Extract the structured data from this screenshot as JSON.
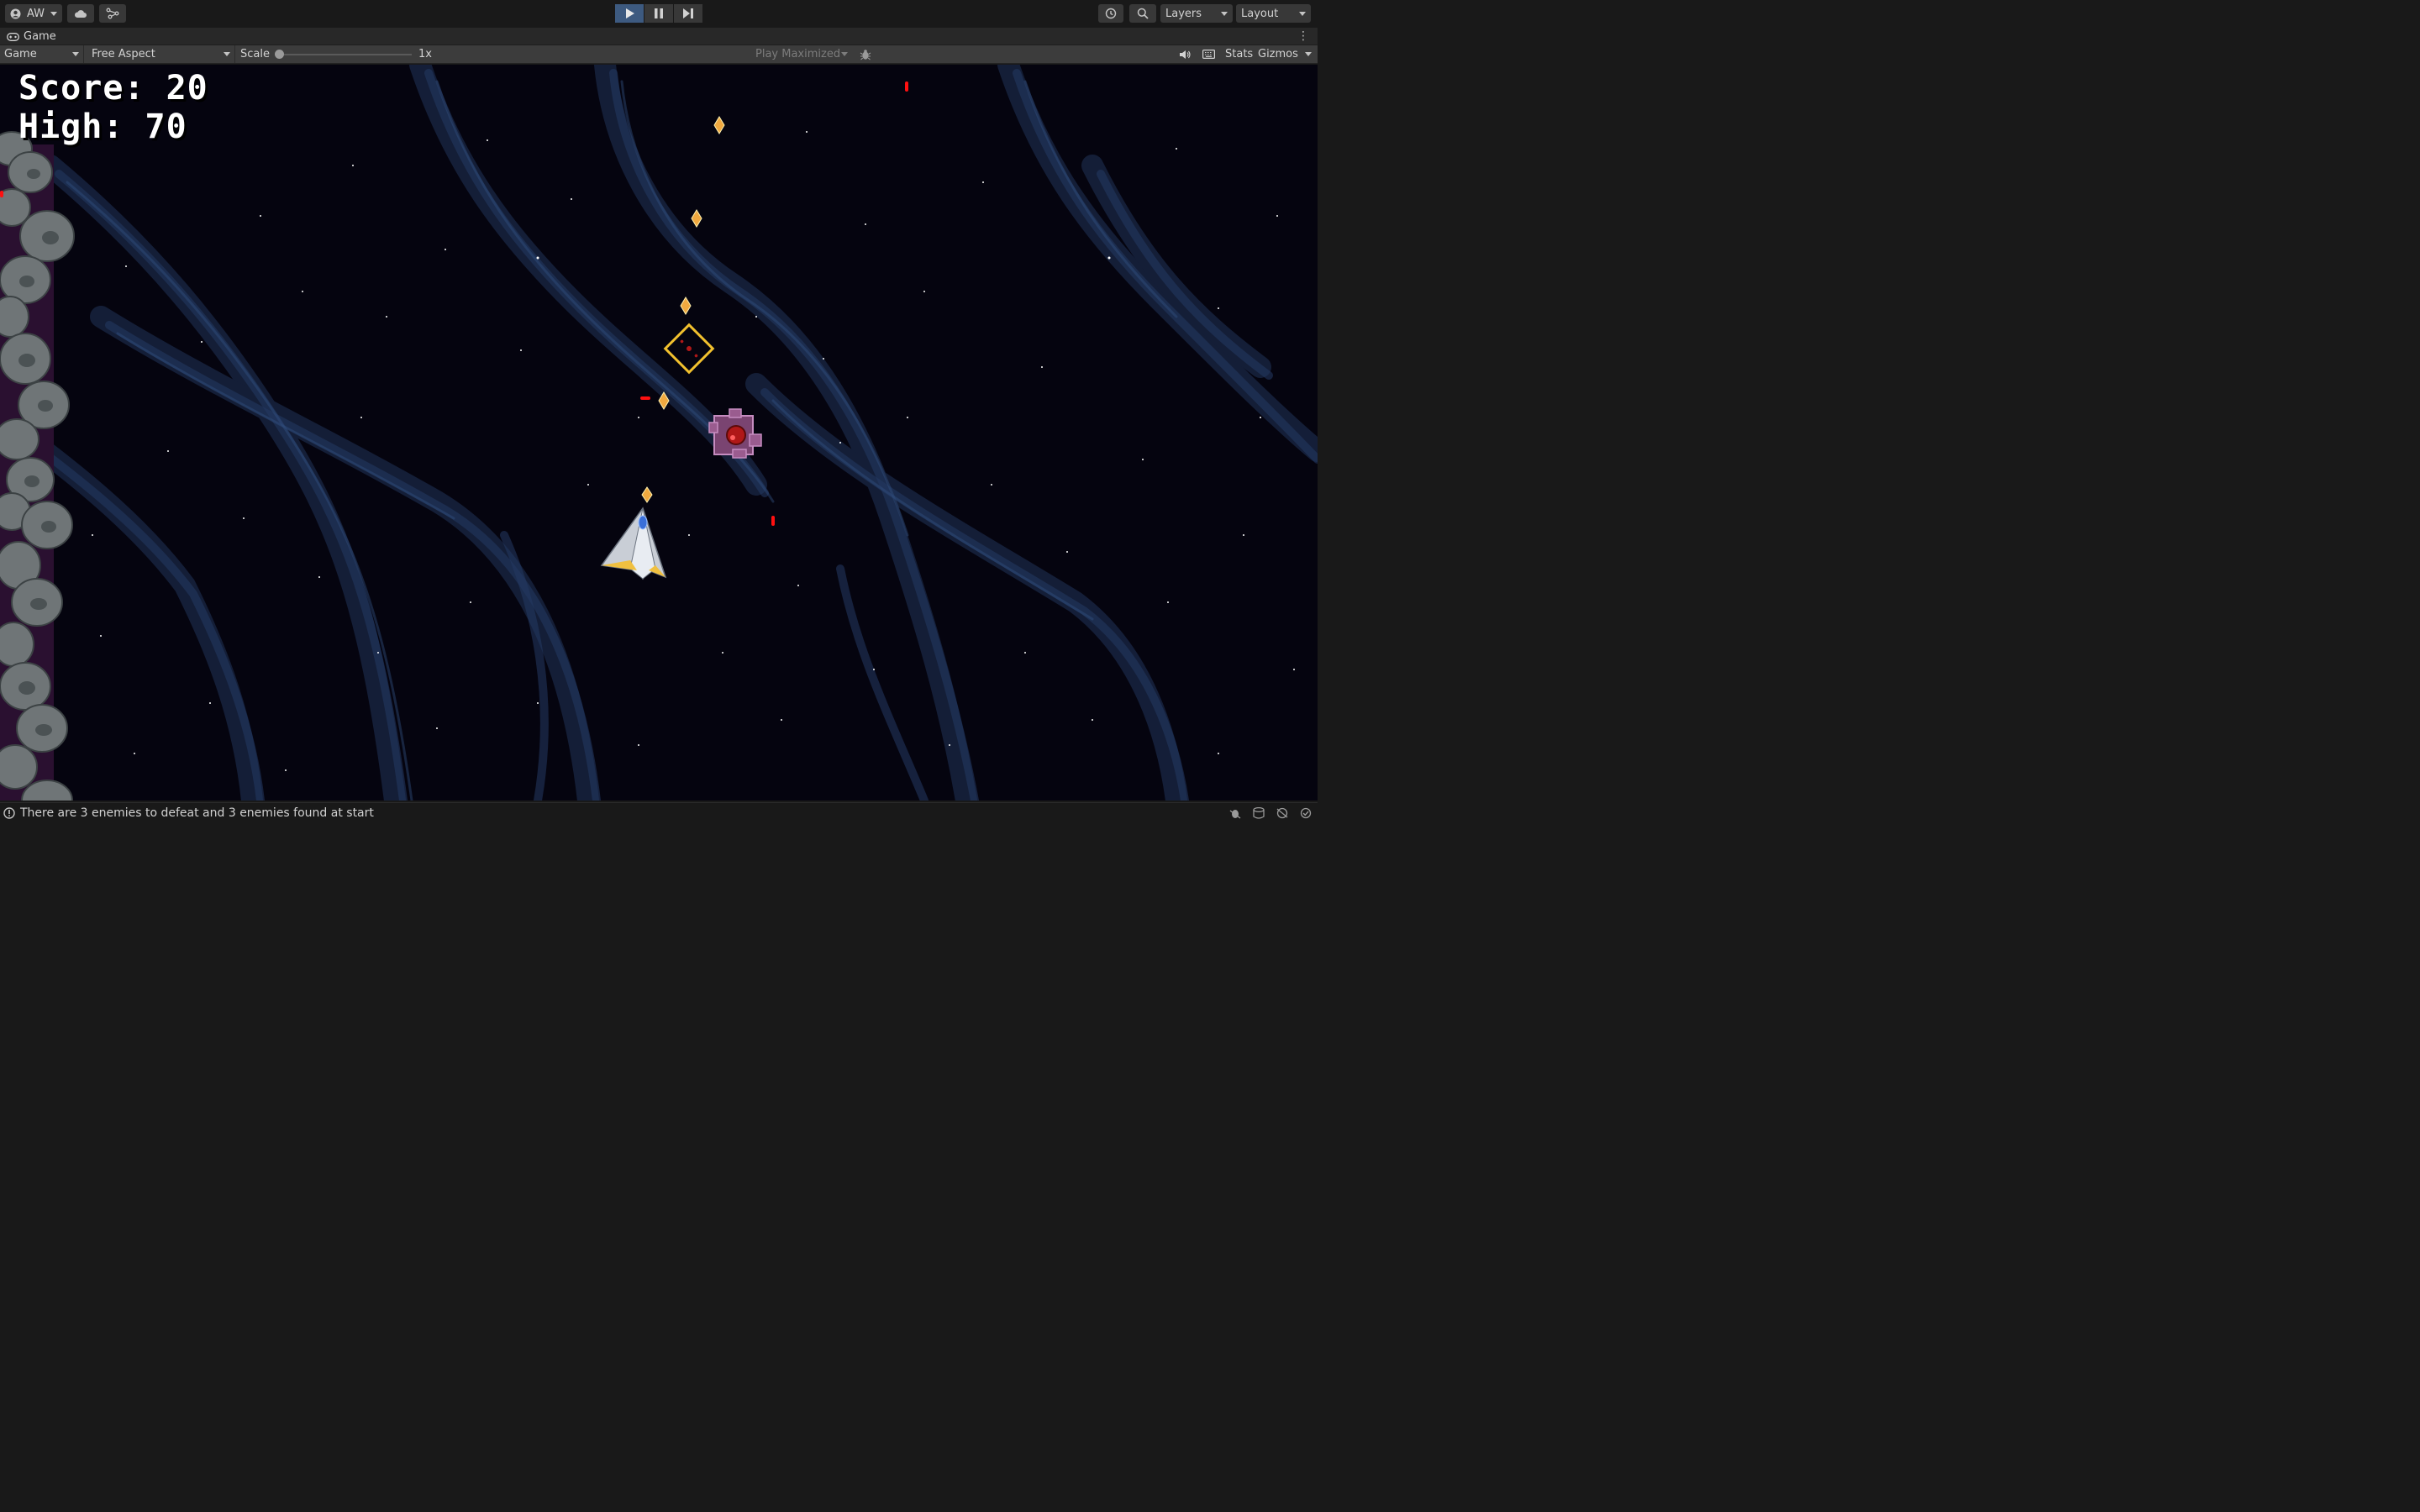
{
  "toolbar": {
    "account_label": "AW",
    "layers_label": "Layers",
    "layout_label": "Layout",
    "icons": [
      "account-icon",
      "cloud-icon",
      "collab-icon",
      "play-icon",
      "pause-icon",
      "step-icon",
      "history-icon",
      "search-icon"
    ]
  },
  "tab": {
    "title": "Game"
  },
  "game_toolbar": {
    "display": "Game",
    "aspect": "Free Aspect",
    "scale_label": "Scale",
    "scale_value": "1x",
    "play_mode": "Play Maximized",
    "stats_label": "Stats",
    "gizmos_label": "Gizmos"
  },
  "hud": {
    "score": "Score: 20",
    "high": "High: 70"
  },
  "status": {
    "message": "There are 3 enemies to defeat and 3 enemies found at start"
  },
  "colors": {
    "space": "#05040f",
    "nebula": "#1b2a4a",
    "nebula_light": "#2c4470",
    "ship_flame": "#f0a940",
    "enemy_outline": "#f2c12e",
    "enemy_body": "#9a5c8f",
    "enemy_core": "#b01818",
    "laser_red": "#ff1010"
  }
}
